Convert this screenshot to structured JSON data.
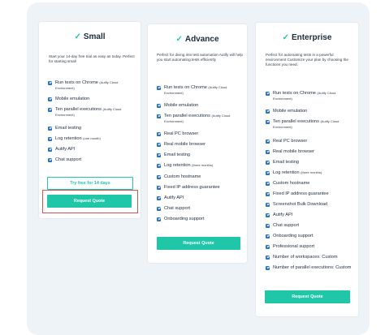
{
  "plans": [
    {
      "name": "Small",
      "description": "Start your 14-day free trial as easy as today. Perfect for starting small",
      "features": [
        {
          "text": "Run tests on Chrome",
          "note": "(Autify Cloud Environment)"
        },
        {
          "text": "Mobile emulation",
          "note": ""
        },
        {
          "text": "Ten parallel executions",
          "note": "(Autify Cloud Environment)"
        },
        {
          "text": "Email testing",
          "note": ""
        },
        {
          "text": "Log retention",
          "note": "(one month)"
        },
        {
          "text": "Autify API",
          "note": ""
        },
        {
          "text": "Chat support",
          "note": ""
        }
      ],
      "trial_label": "Try free for 14 days",
      "quote_label": "Request Quote"
    },
    {
      "name": "Advance",
      "description": "Perfect for diving into test automation Autify will help you start automating tests efficiently",
      "features": [
        {
          "text": "Run tests on Chrome",
          "note": "(Autify Cloud Environment)"
        },
        {
          "text": "Mobile emulation",
          "note": ""
        },
        {
          "text": "Ten parallel executions",
          "note": "(Autify Cloud Environment)"
        },
        {
          "text": "Real PC browser",
          "note": ""
        },
        {
          "text": "Real mobile browser",
          "note": ""
        },
        {
          "text": "Email testing",
          "note": ""
        },
        {
          "text": "Log retention",
          "note": "(three months)"
        },
        {
          "text": "Custom hostname",
          "note": ""
        },
        {
          "text": "Fixed IP address guarantee",
          "note": ""
        },
        {
          "text": "Autify API",
          "note": ""
        },
        {
          "text": "Chat support",
          "note": ""
        },
        {
          "text": "Onboarding support",
          "note": ""
        }
      ],
      "quote_label": "Request Quote"
    },
    {
      "name": "Enterprise",
      "description": "Perfect for automating tests in a powerful environment Customize your plan by choosing the functions you need.",
      "features": [
        {
          "text": "Run tests on Chrome",
          "note": "(Autify Cloud Environment)"
        },
        {
          "text": "Mobile emulation",
          "note": ""
        },
        {
          "text": "Ten parallel executions",
          "note": "(Autify Cloud Environment)"
        },
        {
          "text": "Real PC browser",
          "note": ""
        },
        {
          "text": "Real mobile browser",
          "note": ""
        },
        {
          "text": "Email testing",
          "note": ""
        },
        {
          "text": "Log retention",
          "note": "(three months)"
        },
        {
          "text": "Custom hostname",
          "note": ""
        },
        {
          "text": "Fixed IP address guarantee",
          "note": ""
        },
        {
          "text": "Screenshot Bulk Download",
          "note": ""
        },
        {
          "text": "Autify API",
          "note": ""
        },
        {
          "text": "Chat support",
          "note": ""
        },
        {
          "text": "Onboarding support",
          "note": ""
        },
        {
          "text": "Professional support",
          "note": ""
        },
        {
          "text": "Number of workspaces: Custom",
          "note": ""
        },
        {
          "text": "Number of parallel executions: Custom",
          "note": ""
        }
      ],
      "quote_label": "Request Quote"
    }
  ],
  "colors": {
    "accent": "#1fc7a8",
    "checkbox": "#2471c5",
    "highlight": "#d9534f"
  }
}
